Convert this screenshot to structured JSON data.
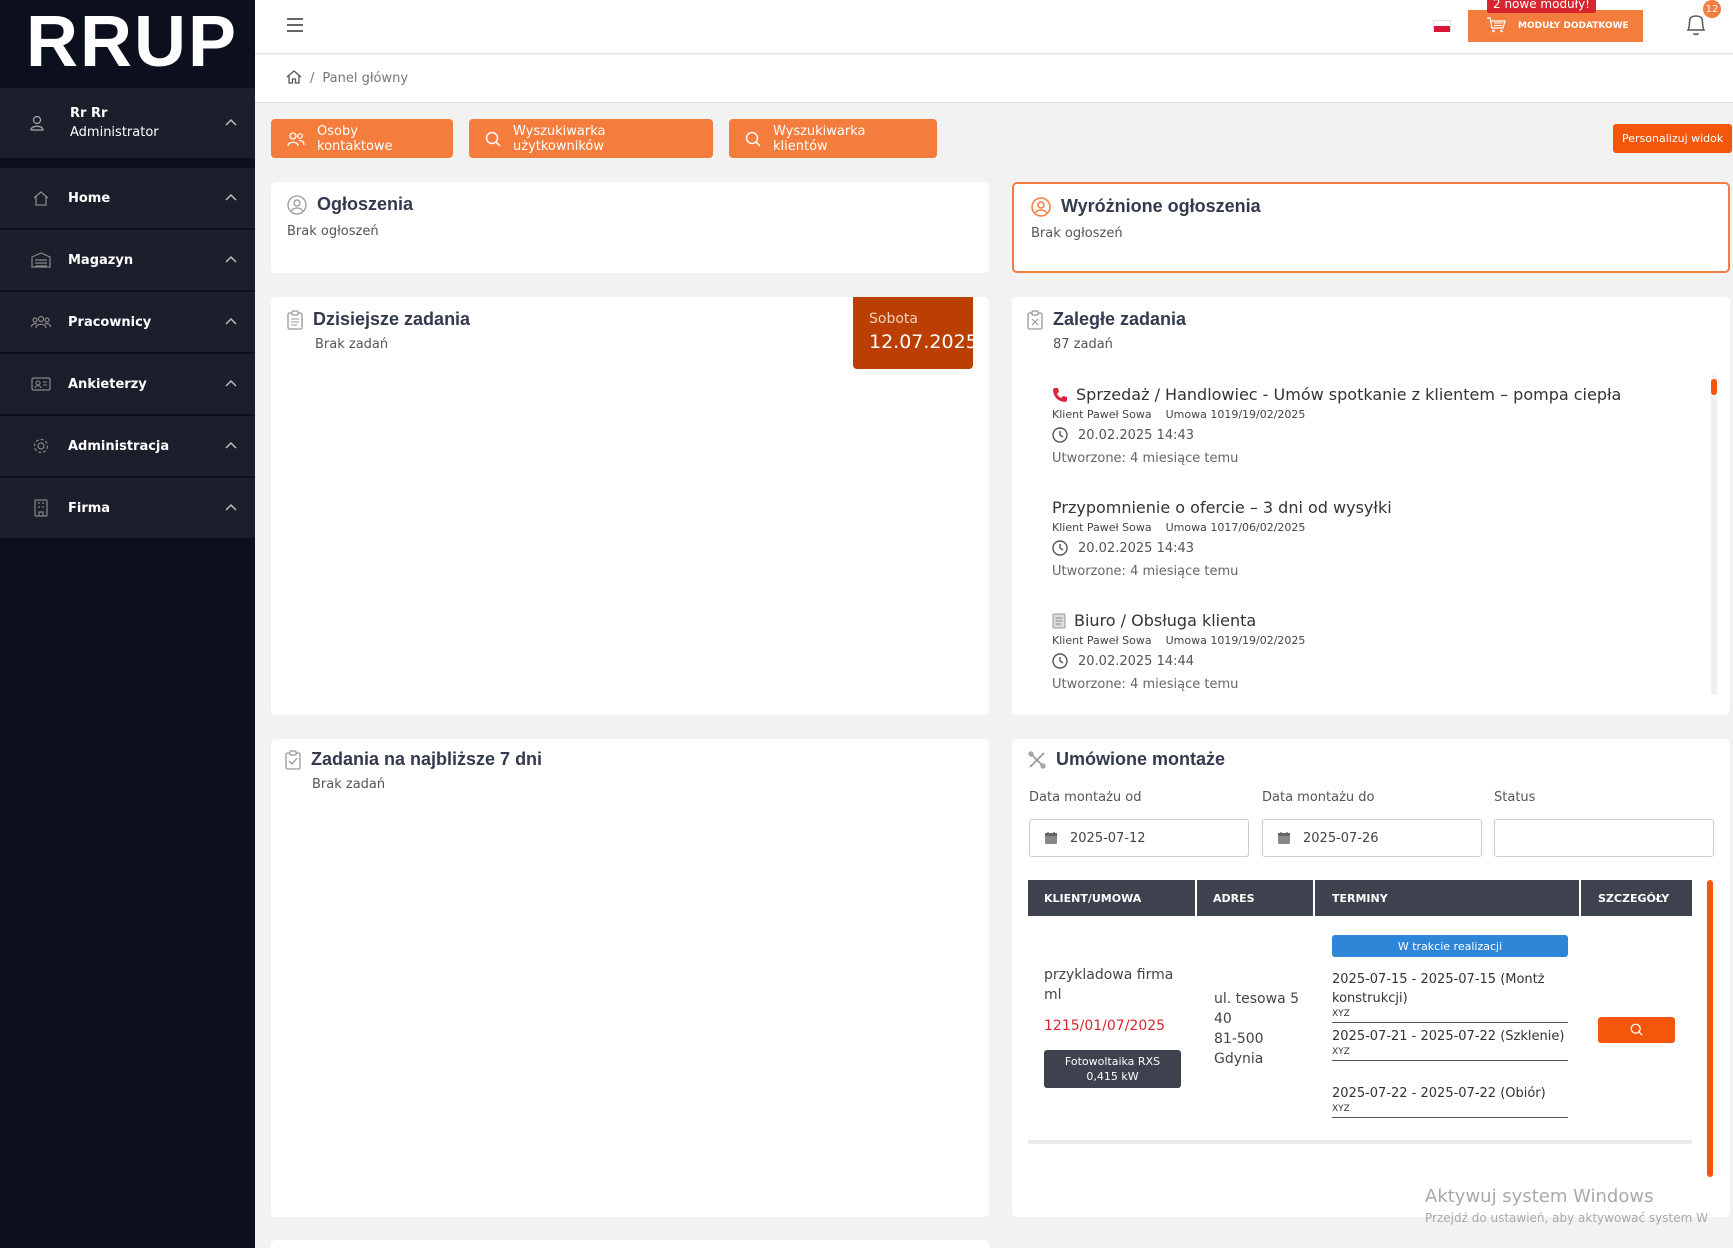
{
  "app": {
    "logo": "RRUP"
  },
  "user": {
    "name": "Rr Rr",
    "role": "Administrator"
  },
  "sidebar": {
    "items": [
      {
        "label": "Home",
        "icon": "home-icon"
      },
      {
        "label": "Magazyn",
        "icon": "warehouse-icon"
      },
      {
        "label": "Pracownicy",
        "icon": "users-icon"
      },
      {
        "label": "Ankieterzy",
        "icon": "id-card-icon"
      },
      {
        "label": "Administracja",
        "icon": "gear-icon"
      },
      {
        "label": "Firma",
        "icon": "building-icon"
      }
    ]
  },
  "topbar": {
    "modules_badge": "2 nowe moduły!",
    "modules_button": "MODUŁY DODATKOWE",
    "notifications_count": "12",
    "language_flag": "pl"
  },
  "breadcrumb": {
    "current": "Panel główny"
  },
  "actions": {
    "contacts": "Osoby kontaktowe",
    "user_search": "Wyszukiwarka użytkowników",
    "client_search": "Wyszukiwarka klientów",
    "personalize": "Personalizuj widok"
  },
  "announcements": {
    "title": "Ogłoszenia",
    "empty": "Brak ogłoszeń"
  },
  "featured": {
    "title": "Wyróżnione ogłoszenia",
    "empty": "Brak ogłoszeń"
  },
  "today": {
    "title": "Dzisiejsze zadania",
    "empty": "Brak zadań",
    "day": "Sobota",
    "date": "12.07.2025"
  },
  "overdue": {
    "title": "Zaległe zadania",
    "count": "87 zadań",
    "tasks": [
      {
        "title": "Sprzedaż / Handlowiec - Umów spotkanie z klientem – pompa ciepła",
        "icon": "phone-icon",
        "client": "Klient Paweł Sowa",
        "contract": "Umowa 1019/19/02/2025",
        "datetime": "20.02.2025 14:43",
        "created": "Utworzone: 4 miesiące temu"
      },
      {
        "title": "Przypomnienie o ofercie – 3 dni od wysyłki",
        "icon": "",
        "client": "Klient Paweł Sowa",
        "contract": "Umowa 1017/06/02/2025",
        "datetime": "20.02.2025 14:43",
        "created": "Utworzone: 4 miesiące temu"
      },
      {
        "title": "Biuro / Obsługa klienta",
        "icon": "document-icon",
        "client": "Klient Paweł Sowa",
        "contract": "Umowa 1019/19/02/2025",
        "datetime": "20.02.2025 14:44",
        "created": "Utworzone: 4 miesiące temu"
      }
    ]
  },
  "week": {
    "title": "Zadania na najbliższe 7 dni",
    "empty": "Brak zadań"
  },
  "montaze": {
    "title": "Umówione montaże",
    "filters": {
      "from_label": "Data montażu od",
      "from_value": "2025-07-12",
      "to_label": "Data montażu do",
      "to_value": "2025-07-26",
      "status_label": "Status",
      "status_value": ""
    },
    "columns": [
      "KLIENT/UMOWA",
      "ADRES",
      "TERMINY",
      "SZCZEGÓŁY"
    ],
    "row": {
      "client": "przykladowa firma ml",
      "contract": "1215/01/07/2025",
      "product_line1": "Fotowoltaika RXS",
      "product_line2": "0,415 kW",
      "address": [
        "ul. tesowa 5",
        "40",
        "81-500",
        "Gdynia"
      ],
      "status": "W trakcie realizacji",
      "terms": [
        {
          "text": "2025-07-15 - 2025-07-15 (Montż konstrukcji)",
          "note": "XYZ"
        },
        {
          "text": "2025-07-21 - 2025-07-22 (Szklenie)",
          "note": "XYZ"
        },
        {
          "text": "2025-07-22 - 2025-07-22 (Obiór)",
          "note": "XYZ"
        }
      ]
    }
  },
  "colors": {
    "accent": "#f47c3c",
    "accent_dark": "#f4570b",
    "date_badge": "#bb3e03",
    "sidebar": "#0b0f1e",
    "status_blue": "#2d86d8",
    "contract_red": "#d9262e"
  },
  "watermark": {
    "line1": "Aktywuj system Windows",
    "line2": "Przejdź do ustawień, aby aktywować system W"
  }
}
